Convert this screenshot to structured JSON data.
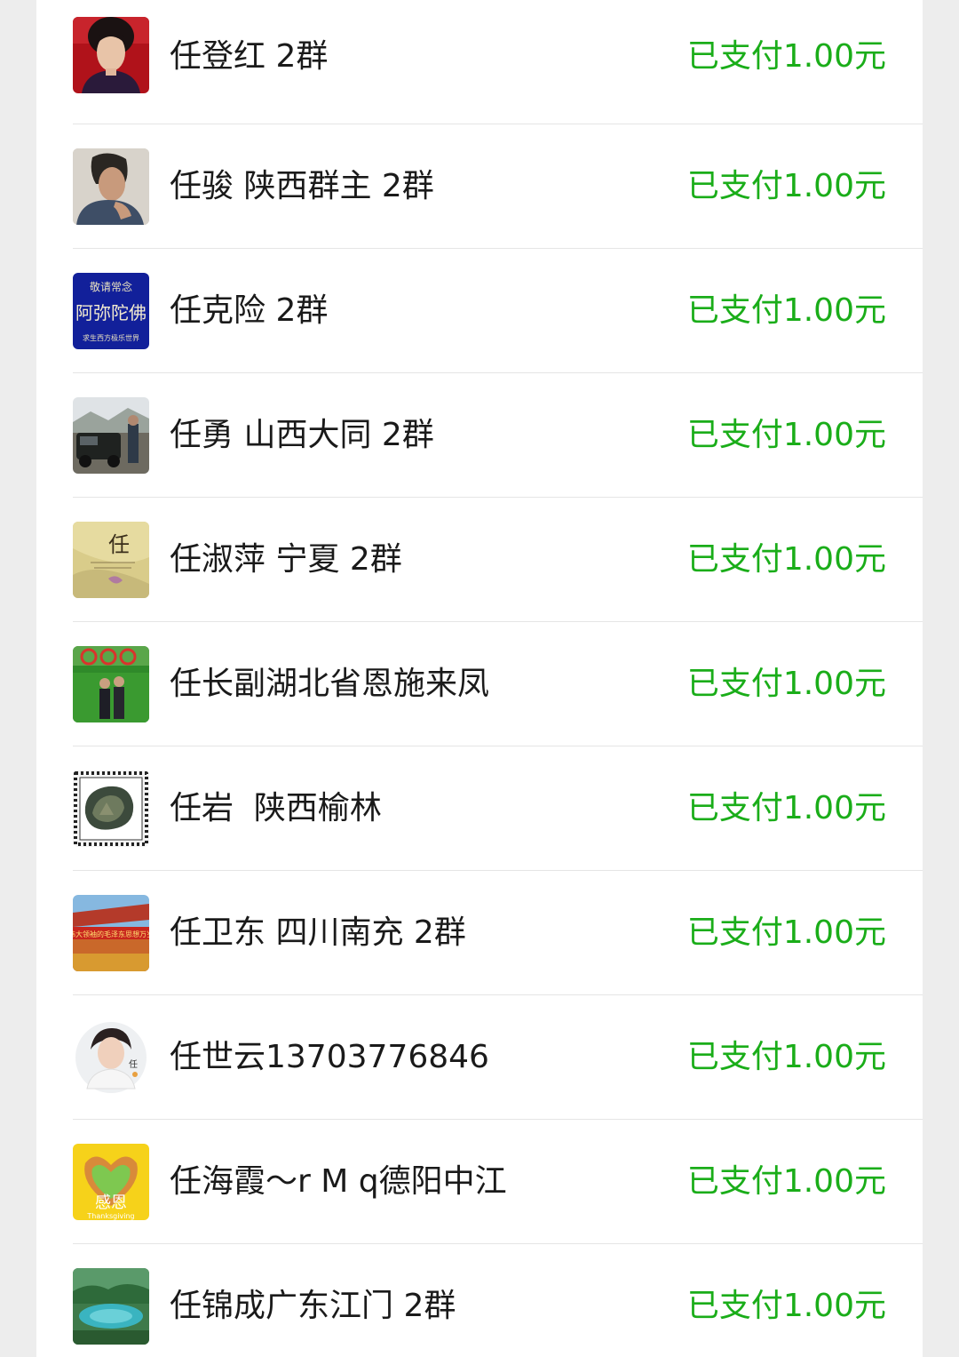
{
  "colors": {
    "paid_green": "#1aad19",
    "background": "#ededed",
    "panel": "#ffffff",
    "divider": "#e5e5e5"
  },
  "payments": [
    {
      "name": "任登红 2群",
      "status": "已支付1.00元",
      "avatar": "woman-portrait-avatar"
    },
    {
      "name": "任骏 陕西群主 2群",
      "status": "已支付1.00元",
      "avatar": "man-portrait-avatar"
    },
    {
      "name": "任克险 2群",
      "status": "已支付1.00元",
      "avatar": "calligraphy-avatar",
      "avatar_text": {
        "top": "敬请常念",
        "main": "阿弥陀佛",
        "bottom": "求生西方极乐世界"
      }
    },
    {
      "name": "任勇 山西大同 2群",
      "status": "已支付1.00元",
      "avatar": "car-photo-avatar"
    },
    {
      "name": "任淑萍 宁夏 2群",
      "status": "已支付1.00元",
      "avatar": "surname-art-avatar",
      "avatar_text": {
        "main": "任"
      }
    },
    {
      "name": "任长副湖北省恩施来凤",
      "status": "已支付1.00元",
      "avatar": "garden-couple-avatar"
    },
    {
      "name": "任岩  陕西榆林",
      "status": "已支付1.00元",
      "avatar": "stamp-rock-avatar"
    },
    {
      "name": "任卫东 四川南充 2群",
      "status": "已支付1.00元",
      "avatar": "tiananmen-banner-avatar",
      "avatar_text": {
        "main": "伟大领袖的毛泽东思想万岁"
      }
    },
    {
      "name": "任世云13703776846",
      "status": "已支付1.00元",
      "avatar": "round-portrait-avatar",
      "avatar_text": {
        "main": "任"
      }
    },
    {
      "name": "任海霞～r M q德阳中江",
      "status": "已支付1.00元",
      "avatar": "heart-hands-avatar",
      "avatar_text": {
        "main": "感恩",
        "sub": "Thanksgiving"
      }
    },
    {
      "name": "任锦成广东江门 2群",
      "status": "已支付1.00元",
      "avatar": "lake-landscape-avatar"
    }
  ]
}
